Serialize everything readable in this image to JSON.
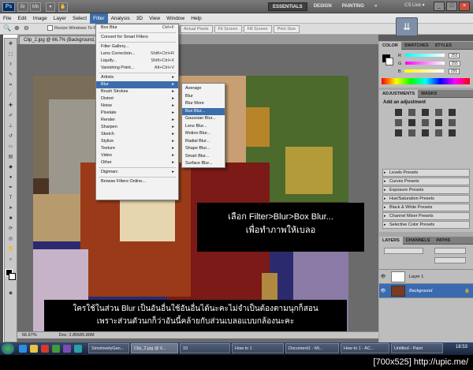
{
  "app": {
    "logo": "Ps",
    "workspaces": [
      "ESSENTIALS",
      "DESIGN",
      "PAINTING",
      "»"
    ],
    "cs_live": "CS Live ▾",
    "window_controls": [
      "_",
      "□",
      "×"
    ]
  },
  "menubar": [
    "File",
    "Edit",
    "Image",
    "Layer",
    "Select",
    "Filter",
    "Analysis",
    "3D",
    "View",
    "Window",
    "Help"
  ],
  "options_bar": {
    "resize_windows": "Resize Windows To Fit",
    "buttons": [
      "Actual Pixels",
      "Fit Screen",
      "Fill Screen",
      "Print Size"
    ]
  },
  "document": {
    "tab_title": "Clip_2.jpg @ 66.7% (Background, RGB/8#)",
    "zoom": "66.67%",
    "doc_size": "Doc: 2.85M/5.80M"
  },
  "filter_menu": [
    {
      "label": "Box Blur",
      "shortcut": "Ctrl+F"
    },
    {
      "sep": true
    },
    {
      "label": "Convert for Smart Filters"
    },
    {
      "sep": true
    },
    {
      "label": "Filter Gallery..."
    },
    {
      "label": "Lens Correction...",
      "shortcut": "Shift+Ctrl+R"
    },
    {
      "label": "Liquify...",
      "shortcut": "Shift+Ctrl+X"
    },
    {
      "label": "Vanishing Point...",
      "shortcut": "Alt+Ctrl+V"
    },
    {
      "sep": true
    },
    {
      "label": "Artistic",
      "sub": true
    },
    {
      "label": "Blur",
      "sub": true,
      "highlight": true
    },
    {
      "label": "Brush Strokes",
      "sub": true
    },
    {
      "label": "Distort",
      "sub": true
    },
    {
      "label": "Noise",
      "sub": true
    },
    {
      "label": "Pixelate",
      "sub": true
    },
    {
      "label": "Render",
      "sub": true
    },
    {
      "label": "Sharpen",
      "sub": true
    },
    {
      "label": "Sketch",
      "sub": true
    },
    {
      "label": "Stylize",
      "sub": true
    },
    {
      "label": "Texture",
      "sub": true
    },
    {
      "label": "Video",
      "sub": true
    },
    {
      "label": "Other",
      "sub": true
    },
    {
      "sep": true
    },
    {
      "label": "Digimarc",
      "sub": true
    },
    {
      "sep": true
    },
    {
      "label": "Browse Filters Online..."
    }
  ],
  "blur_menu": [
    "Average",
    "Blur",
    "Blur More",
    "Box Blur...",
    "Gaussian Blur...",
    "Lens Blur...",
    "Motion Blur...",
    "Radial Blur...",
    "Shape Blur...",
    "Smart Blur...",
    "Surface Blur..."
  ],
  "blur_highlight_index": 3,
  "color_panel": {
    "tabs": [
      "COLOR",
      "SWATCHES",
      "STYLES"
    ],
    "rows": [
      {
        "label": "R",
        "value": "255"
      },
      {
        "label": "G",
        "value": "255"
      },
      {
        "label": "B",
        "value": "255"
      }
    ]
  },
  "adjustments_panel": {
    "tabs": [
      "ADJUSTMENTS",
      "MASKS"
    ],
    "heading": "Add an adjustment",
    "presets": [
      "Levels Presets",
      "Curves Presets",
      "Exposure Presets",
      "Hue/Saturation Presets",
      "Black & White Presets",
      "Channel Mixer Presets",
      "Selective Color Presets"
    ]
  },
  "layers_panel": {
    "tabs": [
      "LAYERS",
      "CHANNELS",
      "PATHS"
    ],
    "layers": [
      {
        "name": "Layer 1",
        "selected": false
      },
      {
        "name": "Background",
        "selected": true
      }
    ]
  },
  "captions": {
    "line1": "เลือก Filter>Blur>Box Blur...",
    "line2": "เพื่อทำภาพให้เบลอ",
    "bottom1": "ใครใช้ในส่วน Blur เป็นอันอื่นใช้อันอื่นได้นะคะไม่จำเป็นต้องตามนุกก็สอน",
    "bottom2": "เพราะส่วนตัวนกก็ว่าอันนี้คล้ายกับส่วนเบลอแบบกล้องนะคะ"
  },
  "taskbar": {
    "items": [
      "SimslovelyGan...",
      "Clip_2.jpg @ 6...",
      "10",
      "How to 1",
      "Document1 - Mi...",
      "How to 1 - AC...",
      "Untitled - Paint"
    ],
    "clock": "18:53"
  },
  "watermark": "[700x525] http://upic.me/"
}
